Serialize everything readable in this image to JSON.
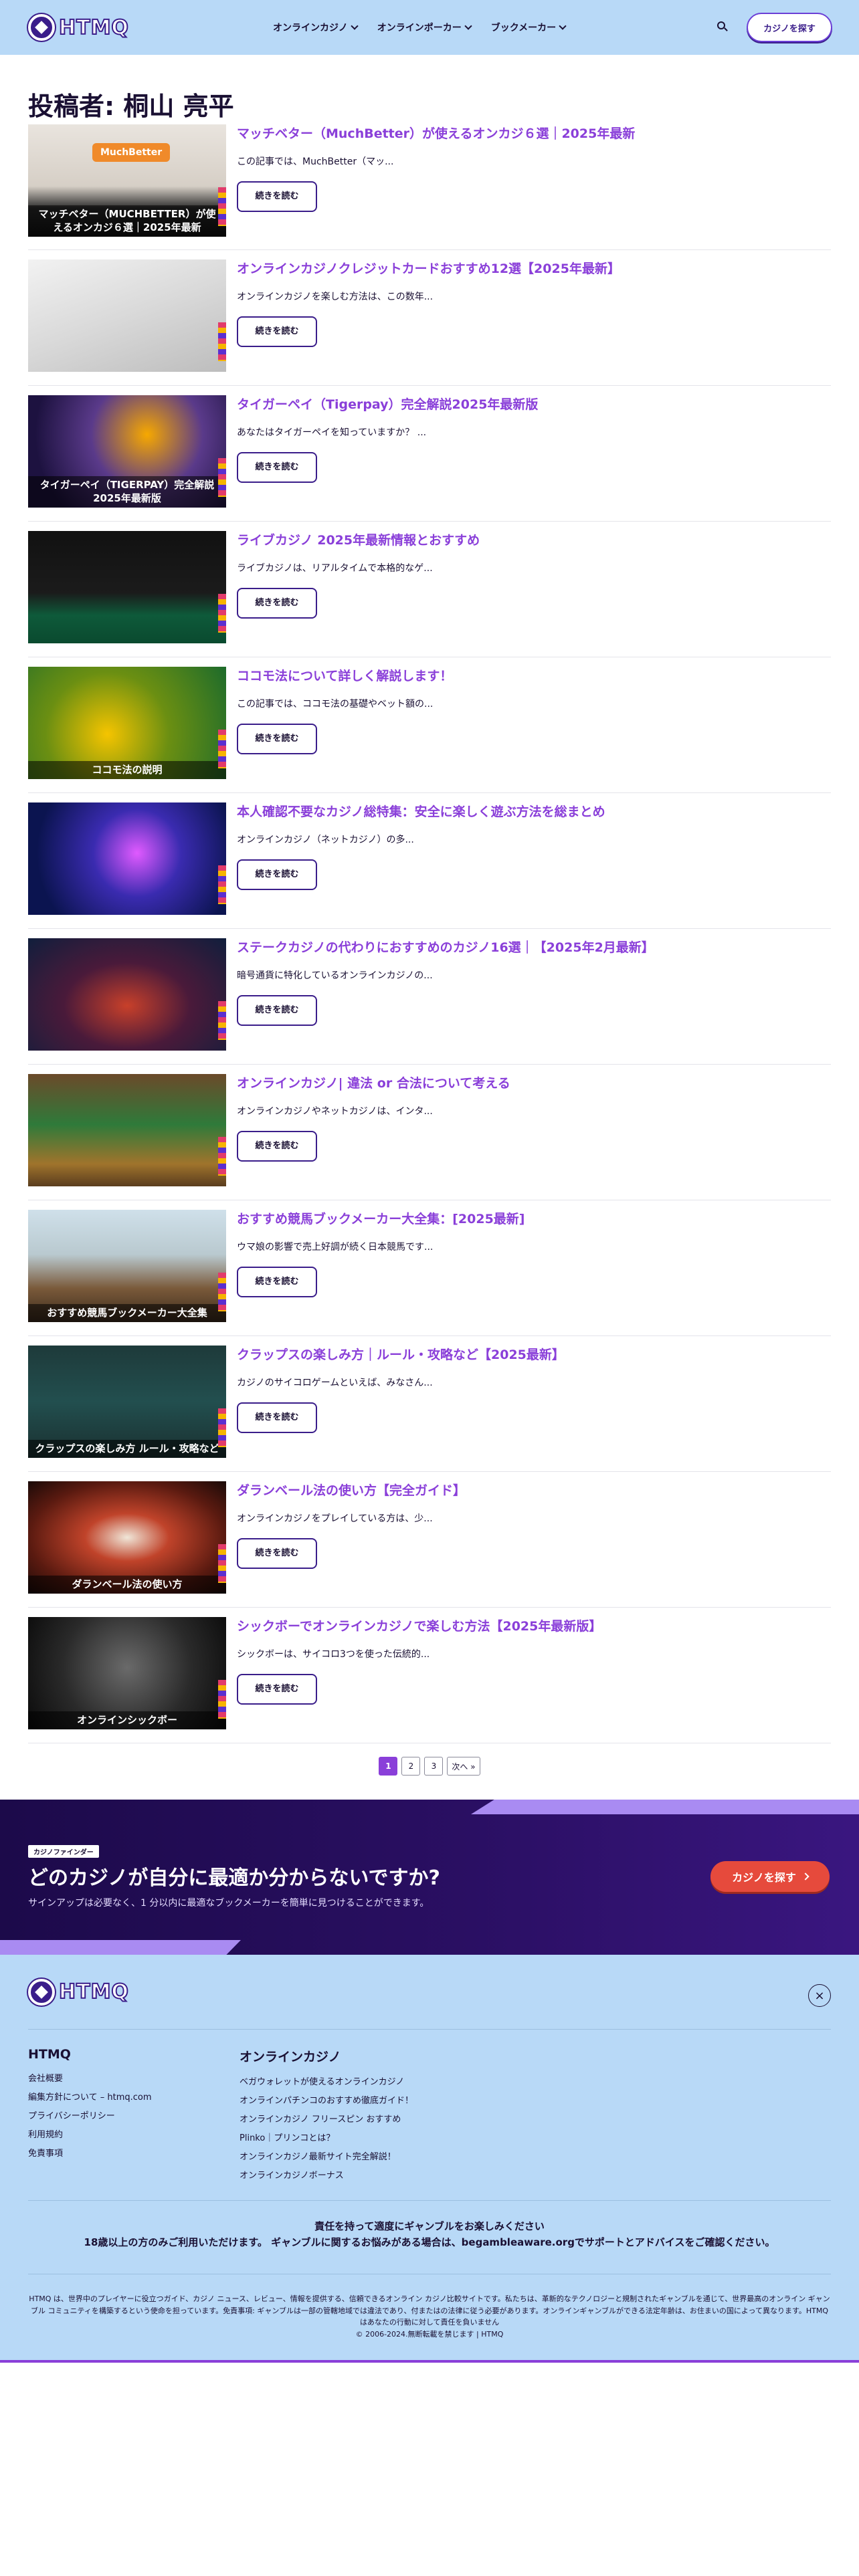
{
  "header": {
    "logo_text": "HTMQ",
    "nav": [
      {
        "label": "オンラインカジノ"
      },
      {
        "label": "オンラインポーカー"
      },
      {
        "label": "ブックメーカー"
      }
    ],
    "cta_label": "カジノを探す"
  },
  "page_title": "投稿者: 桐山 亮平",
  "posts": [
    {
      "title": "マッチベター（MuchBetter）が使えるオンカジ６選｜2025年最新",
      "excerpt": "この記事では、MuchBetter（マッ...",
      "read_more": "続きを読む",
      "thumb_caption": "マッチベター（MUCHBETTER）が使えるオンカジ６選｜2025年最新",
      "thumb_bg": "linear-gradient(180deg,#e9e4de 0%,#d6cfc6 55%,#2b2b2b 75%,#111 100%)",
      "thumb_logo": "MuchBetter"
    },
    {
      "title": "オンラインカジノクレジットカードおすすめ12選【2025年最新】",
      "excerpt": "オンラインカジノを楽しむ方法は、この数年...",
      "read_more": "続きを読む",
      "thumb_caption": "",
      "thumb_bg": "linear-gradient(160deg,#f2f2f2 0%,#d9d9d9 50%,#bdbdbd 100%)"
    },
    {
      "title": "タイガーペイ（Tigerpay）完全解説2025年最新版",
      "excerpt": "あなたはタイガーペイを知っていますか？ ...",
      "read_more": "続きを読む",
      "thumb_caption": "タイガーペイ（TIGERPAY）完全解説2025年最新版",
      "thumb_bg": "radial-gradient(circle at 60% 35%,#f6a800 0%,#5a3a8a 40%,#1d1240 80%)"
    },
    {
      "title": "ライブカジノ 2025年最新情報とおすすめ",
      "excerpt": "ライブカジノは、リアルタイムで本格的なゲ...",
      "read_more": "続きを読む",
      "thumb_caption": "",
      "thumb_bg": "linear-gradient(180deg,#111 0%,#1b1b1b 55%,#0e5a3a 75%,#0a4a2f 100%)"
    },
    {
      "title": "ココモ法について詳しく解説します！",
      "excerpt": "この記事では、ココモ法の基礎やベット額の...",
      "read_more": "続きを読む",
      "thumb_caption": "ココモ法の説明",
      "thumb_bg": "radial-gradient(circle at 40% 60%,#f5c400 0%,#6b8f12 45%,#1d6b2b 100%)"
    },
    {
      "title": "本人確認不要なカジノ総特集：安全に楽しく遊ぶ方法を総まとめ",
      "excerpt": "オンラインカジノ（ネットカジノ）の多...",
      "read_more": "続きを読む",
      "thumb_caption": "",
      "thumb_bg": "radial-gradient(circle at 55% 45%,#e05aff 0%,#3a2bb0 35%,#0b1450 80%)"
    },
    {
      "title": "ステークカジノの代わりにおすすめのカジノ16選｜【2025年2月最新】",
      "excerpt": "暗号通貨に特化しているオンラインカジノの...",
      "read_more": "続きを読む",
      "thumb_caption": "",
      "thumb_bg": "radial-gradient(ellipse at 50% 60%,#c8402a 0%,#4a1a3a 45%,#101e3c 100%)"
    },
    {
      "title": "オンラインカジノ| 違法 or 合法について考える",
      "excerpt": "オンラインカジノやネットカジノは、インタ...",
      "read_more": "続きを読む",
      "thumb_caption": "",
      "thumb_bg": "linear-gradient(180deg,#6b4a2a 0%,#2f7a3a 45%,#a0742c 80%,#5a3d1e 100%)"
    },
    {
      "title": "おすすめ競馬ブックメーカー大全集：[2025最新]",
      "excerpt": "ウマ娘の影響で売上好調が続く日本競馬です...",
      "read_more": "続きを読む",
      "thumb_caption": "おすすめ競馬ブックメーカー大全集",
      "thumb_bg": "linear-gradient(180deg,#cfe0ea 0%,#b9c9cf 40%,#7a5a3a 70%,#3b2a1c 100%)"
    },
    {
      "title": "クラップスの楽しみ方｜ルール・攻略など【2025最新】",
      "excerpt": "カジノのサイコロゲームといえば、みなさん...",
      "read_more": "続きを読む",
      "thumb_caption": "クラップスの楽しみ方 ルール・攻略など",
      "thumb_bg": "linear-gradient(180deg,#1e3a3a 0%,#224f4f 50%,#1a3030 100%)"
    },
    {
      "title": "ダランベール法の使い方【完全ガイド】",
      "excerpt": "オンラインカジノをプレイしている方は、少...",
      "read_more": "続きを読む",
      "thumb_caption": "ダランベール法の使い方",
      "thumb_bg": "radial-gradient(ellipse at 50% 50%,#f0e6d8 0%,#c0432a 30%,#5a1a10 70%,#1a0a08 100%)"
    },
    {
      "title": "シックボーでオンラインカジノで楽しむ方法【2025年最新版】",
      "excerpt": "シックボーは、サイコロ3つを使った伝統的...",
      "read_more": "続きを読む",
      "thumb_caption": "オンラインシックボー",
      "thumb_bg": "radial-gradient(circle at 50% 45%,#6a6a6a 0%,#2a2a2a 55%,#0a0a0a 100%)"
    }
  ],
  "pagination": {
    "pages": [
      "1",
      "2",
      "3"
    ],
    "next": "次へ »",
    "current": "1"
  },
  "banner": {
    "tag": "カジノファインダー",
    "title": "どのカジノが自分に最適か分からないですか?",
    "subtitle": "サインアップは必要なく、1 分以内に最適なブックメーカーを簡単に見つけることができます。",
    "cta": "カジノを探す"
  },
  "footer": {
    "logo_text": "HTMQ",
    "close_label": "×",
    "col1": {
      "title": "HTMQ",
      "links": [
        "会社概要",
        "編集方針について – htmq.com",
        "プライバシーポリシー",
        "利用規約",
        "免責事項"
      ]
    },
    "col2": {
      "title": "オンラインカジノ",
      "links": [
        "ベガウォレットが使えるオンラインカジノ",
        "オンラインパチンコのおすすめ徹底ガイド！",
        "オンラインカジノ フリースピン おすすめ",
        "Plinko｜プリンコとは？",
        "オンラインカジノ最新サイト完全解説！",
        "オンラインカジノボーナス"
      ]
    },
    "responsible_1": "責任を持って適度にギャンブルをお楽しみください",
    "responsible_2": "18歳以上の方のみご利用いただけます。 ギャンブルに関するお悩みがある場合は、begambleaware.orgでサポートとアドバイスをご確認ください。",
    "disclaimer": "HTMQ は、世界中のプレイヤーに役立つガイド、カジノ ニュース、レビュー、情報を提供する、信頼できるオンライン カジノ比較サイトです。私たちは、革新的なテクノロジーと規制されたギャンブルを通じて、世界最高のオンライン ギャンブル コミュニティを構築するという使命を担っています。免責事項: ギャンブルは一部の管轄地域では違法であり、付またはの法律に従う必要があります。オンラインギャンブルができる法定年齢は、お住まいの国によって異なります。HTMQ はあなたの行動に対して責任を負いません",
    "copyright": "© 2006-2024.無断転載を禁じます | HTMQ"
  }
}
